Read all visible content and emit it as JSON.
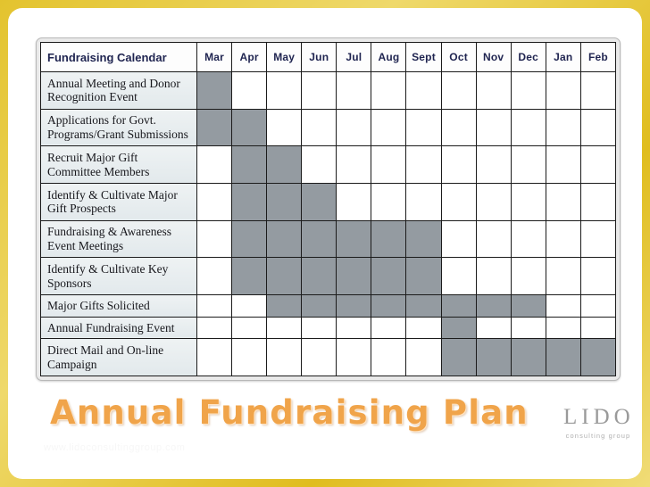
{
  "slide": {
    "title": "Annual Fundraising Plan",
    "watermark": "www.lidoconsultinggroup.com"
  },
  "brand": {
    "mark": "LIDO",
    "sub": "consulting group"
  },
  "colors": {
    "frame": "#e0bd1f",
    "card": "#ffffff",
    "filled_cell": "#949ba1",
    "task_cell": "#e8eef0",
    "header_text": "#1f2450",
    "title_text": "#f0a44a"
  },
  "chart_data": {
    "type": "table",
    "title": "Fundraising Calendar",
    "xlabel": "",
    "ylabel": "",
    "grid": true,
    "legend": "none",
    "task_header": "Fundraising Calendar",
    "categories": [
      "Mar",
      "Apr",
      "May",
      "Jun",
      "Jul",
      "Aug",
      "Sept",
      "Oct",
      "Nov",
      "Dec",
      "Jan",
      "Feb"
    ],
    "rows": [
      {
        "task": "Annual Meeting and Donor Recognition Event",
        "values": [
          1,
          0,
          0,
          0,
          0,
          0,
          0,
          0,
          0,
          0,
          0,
          0
        ],
        "span": [
          "Mar",
          "Mar"
        ]
      },
      {
        "task": "Applications for Govt. Programs/Grant Submissions",
        "values": [
          1,
          1,
          0,
          0,
          0,
          0,
          0,
          0,
          0,
          0,
          0,
          0
        ],
        "span": [
          "Mar",
          "Apr"
        ]
      },
      {
        "task": "Recruit Major Gift Committee Members",
        "values": [
          0,
          1,
          1,
          0,
          0,
          0,
          0,
          0,
          0,
          0,
          0,
          0
        ],
        "span": [
          "Apr",
          "May"
        ]
      },
      {
        "task": "Identify & Cultivate Major Gift Prospects",
        "values": [
          0,
          1,
          1,
          1,
          0,
          0,
          0,
          0,
          0,
          0,
          0,
          0
        ],
        "span": [
          "Apr",
          "Jun"
        ]
      },
      {
        "task": "Fundraising & Awareness Event Meetings",
        "values": [
          0,
          1,
          1,
          1,
          1,
          1,
          1,
          0,
          0,
          0,
          0,
          0
        ],
        "span": [
          "Apr",
          "Sept"
        ]
      },
      {
        "task": "Identify & Cultivate Key Sponsors",
        "values": [
          0,
          1,
          1,
          1,
          1,
          1,
          1,
          0,
          0,
          0,
          0,
          0
        ],
        "span": [
          "Apr",
          "Sept"
        ]
      },
      {
        "task": "Major Gifts Solicited",
        "values": [
          0,
          0,
          1,
          1,
          1,
          1,
          1,
          1,
          1,
          1,
          0,
          0
        ],
        "span": [
          "May",
          "Dec"
        ]
      },
      {
        "task": "Annual Fundraising Event",
        "values": [
          0,
          0,
          0,
          0,
          0,
          0,
          0,
          1,
          0,
          0,
          0,
          0
        ],
        "span": [
          "Oct",
          "Oct"
        ]
      },
      {
        "task": "Direct Mail and On-line Campaign",
        "values": [
          0,
          0,
          0,
          0,
          0,
          0,
          0,
          1,
          1,
          1,
          1,
          1
        ],
        "span": [
          "Oct",
          "Feb"
        ]
      }
    ]
  }
}
